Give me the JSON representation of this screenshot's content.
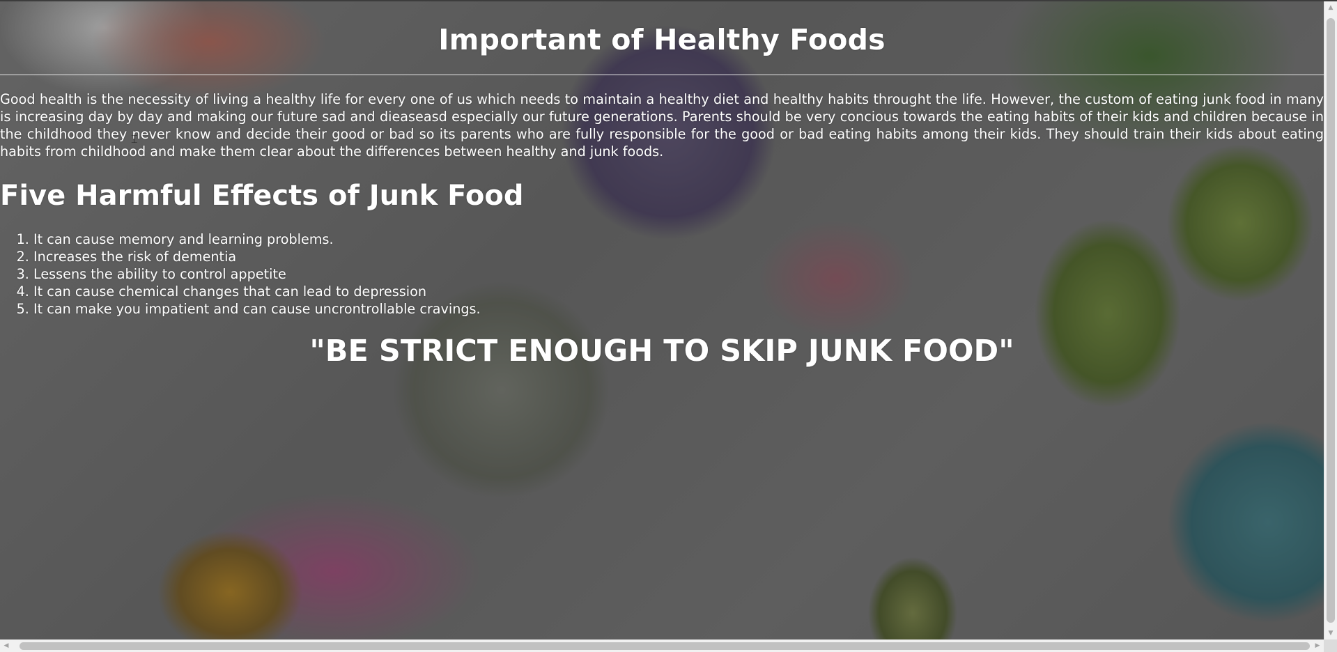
{
  "page": {
    "title": "Important of Healthy Foods",
    "intro": "Good health is the necessity of living a healthy life for every one of us which needs to maintain a healthy diet and healthy habits throught the life. However, the custom of eating junk food in many is increasing day by day and making our future sad and dieaseasd especially our future generations. Parents should be very concious towards the eating habits of their kids and children because in the childhood they never know and decide their good or bad so its parents who are fully responsible for the good or bad eating habits among their kids. They should train their kids about eating habits from childhood and make them clear about the differences between healthy and junk foods.",
    "subheading": "Five Harmful Effects of Junk Food",
    "effects": [
      "It can cause memory and learning problems.",
      "Increases the risk of dementia",
      "Lessens the ability to control appetite",
      "It can cause chemical changes that can lead to depression",
      "It can make you impatient and can cause uncrontrollable cravings."
    ],
    "quote": "\"BE STRICT ENOUGH TO SKIP JUNK FOOD\""
  },
  "scrollbars": {
    "up_icon": "arrow-up-icon",
    "down_icon": "arrow-down-icon",
    "left_icon": "arrow-left-icon",
    "right_icon": "arrow-right-icon"
  },
  "colors": {
    "text": "#ffffff",
    "scrollbar_track": "#f1f1f1",
    "scrollbar_thumb": "#c1c1c1"
  }
}
